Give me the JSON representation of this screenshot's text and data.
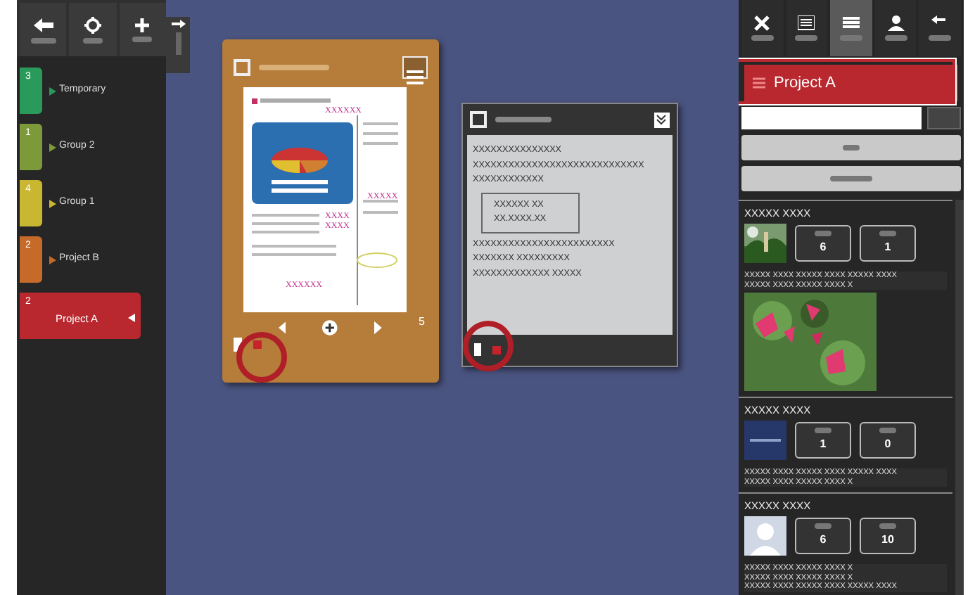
{
  "left_panel": {
    "groups": [
      {
        "count": "3",
        "name": "Temporary",
        "color": "#2a9a5a",
        "selected": false
      },
      {
        "count": "1",
        "name": "Group 2",
        "color": "#7c9a3a",
        "selected": false
      },
      {
        "count": "4",
        "name": "Group 1",
        "color": "#c9b631",
        "selected": false
      },
      {
        "count": "2",
        "name": "Project B",
        "color": "#c56a28",
        "selected": false
      },
      {
        "count": "2",
        "name": "Project A",
        "color": "#b8282e",
        "selected": true
      }
    ]
  },
  "cork_card": {
    "checked": false,
    "marks": [
      "XXXXXX",
      "XXXXX",
      "XXXX",
      "XXXX",
      "XXXXXX"
    ],
    "page": "5"
  },
  "note_card": {
    "checked": false,
    "body": [
      {
        "kind": "line",
        "text": "XXXXXXXXXXXXXXX"
      },
      {
        "kind": "line",
        "text": "XXXXXXXXXXXXXXXXXXXXXXXXXXXXX"
      },
      {
        "kind": "line",
        "text": "XXXXXXXXXXXX"
      },
      {
        "kind": "box",
        "lines": [
          "XXXXXX XX",
          "XX.XXXX.XX"
        ]
      },
      {
        "kind": "line",
        "text": "XXXXXXXXXXXXXXXXXXXXXXXX"
      },
      {
        "kind": "line",
        "text": "XXXXXXX  XXXXXXXXX"
      },
      {
        "kind": "line",
        "text": "XXXXXXXXXXXXX  XXXXX"
      }
    ]
  },
  "right_panel": {
    "tabs": [
      {
        "kind": "close",
        "selected": false
      },
      {
        "kind": "list",
        "selected": false
      },
      {
        "kind": "menu",
        "selected": true
      },
      {
        "kind": "person",
        "selected": false
      },
      {
        "kind": "arrow",
        "selected": false
      }
    ],
    "project": "Project A",
    "feed": [
      {
        "title": "XXXXX XXXX",
        "kind": "picture",
        "stats": [
          "6",
          "1"
        ],
        "text_lines": [
          "XXXXX XXXX XXXXX XXXX XXXXX XXXX",
          "XXXXX XXXX XXXXX XXXX X"
        ],
        "photo": true
      },
      {
        "title": "XXXXX XXXX",
        "kind": "logo",
        "stats": [
          "1",
          "0"
        ],
        "text_lines": [
          "XXXXX XXXX XXXXX XXXX XXXXX XXXX",
          "XXXXX XXXX XXXXX XXXX X"
        ],
        "photo": false
      },
      {
        "title": "XXXXX XXXX",
        "kind": "avatar",
        "stats": [
          "6",
          "10"
        ],
        "text_lines": [
          "XXXXX XXXX XXXXX XXXX X",
          "XXXXX XXXX XXXXX XXXX X",
          "XXXXX XXXX XXXXX XXXX XXXXX XXXX"
        ],
        "photo": false
      }
    ]
  }
}
